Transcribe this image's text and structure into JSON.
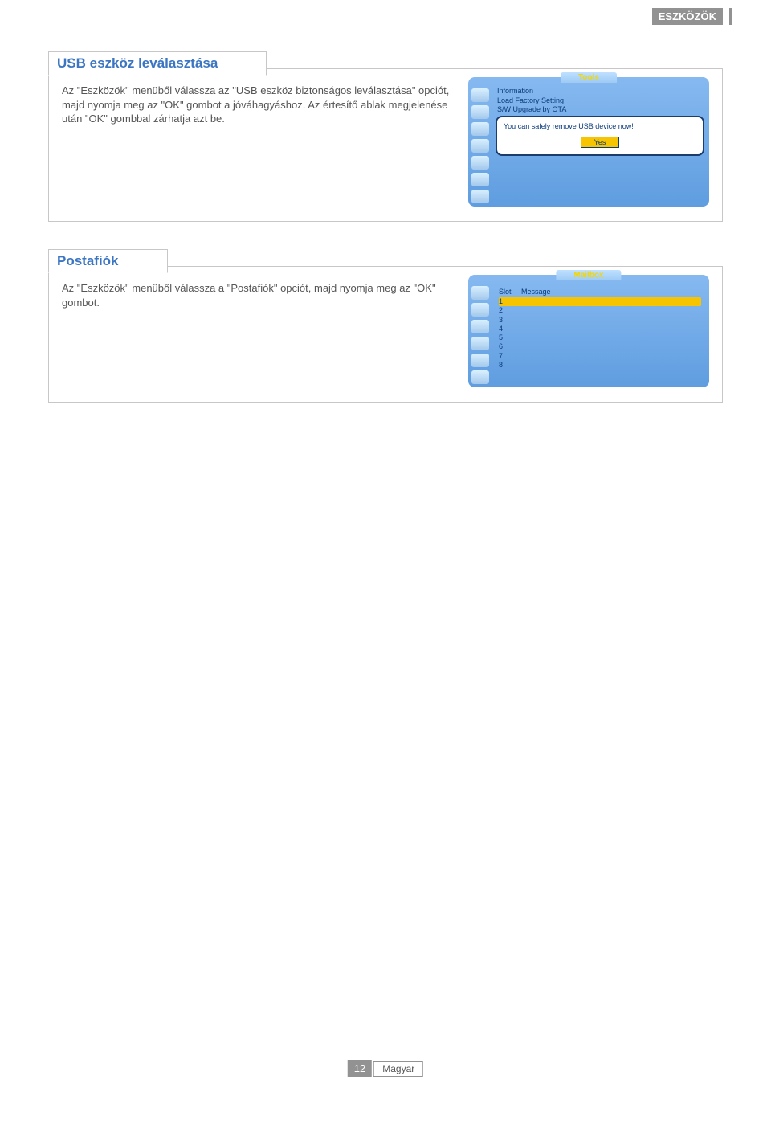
{
  "page_header": "ESZKÖZÖK",
  "section1": {
    "title": "USB eszköz leválasztása",
    "body": "Az \"Eszközök\" menüből válassza az \"USB eszköz biztonságos leválasztása\" opciót, majd nyomja meg az \"OK\" gombot a jóváhagyáshoz. Az értesítő ablak megjelenése után \"OK\" gombbal zárhatja azt be.",
    "panel": {
      "tab": "Tools",
      "menu": [
        "Information",
        "Load Factory Setting",
        "S/W Upgrade by OTA"
      ],
      "popup_text": "You can safely remove USB device now!",
      "popup_button": "Yes"
    }
  },
  "section2": {
    "title": "Postafiók",
    "body": "Az \"Eszközök\" menüből válassza a \"Postafiók\" opciót, majd nyomja meg az \"OK\" gombot.",
    "panel": {
      "tab": "Mailbox",
      "col_slot": "Slot",
      "col_message": "Message",
      "rows": [
        "1",
        "2",
        "3",
        "4",
        "5",
        "6",
        "7",
        "8"
      ]
    }
  },
  "footer": {
    "page": "12",
    "lang": "Magyar"
  }
}
